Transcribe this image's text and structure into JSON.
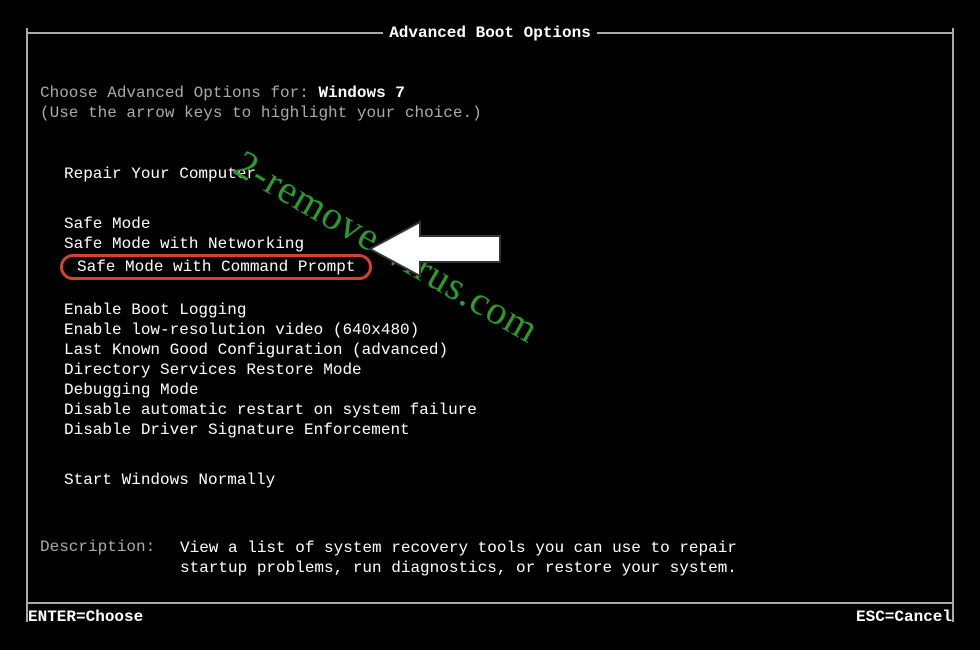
{
  "title": "Advanced Boot Options",
  "choose_prefix": "Choose Advanced Options for: ",
  "os_name": "Windows 7",
  "hint": "(Use the arrow keys to highlight your choice.)",
  "repair": "Repair Your Computer",
  "options_a": [
    "Safe Mode",
    "Safe Mode with Networking",
    "Safe Mode with Command Prompt"
  ],
  "options_b": [
    "Enable Boot Logging",
    "Enable low-resolution video (640x480)",
    "Last Known Good Configuration (advanced)",
    "Directory Services Restore Mode",
    "Debugging Mode",
    "Disable automatic restart on system failure",
    "Disable Driver Signature Enforcement"
  ],
  "start_normal": "Start Windows Normally",
  "description_label": "Description:",
  "description_text": "View a list of system recovery tools you can use to repair startup problems, run diagnostics, or restore your system.",
  "footer_left": "ENTER=Choose",
  "footer_right": "ESC=Cancel",
  "watermark": "2-remove-virus.com",
  "highlight_index": 2
}
